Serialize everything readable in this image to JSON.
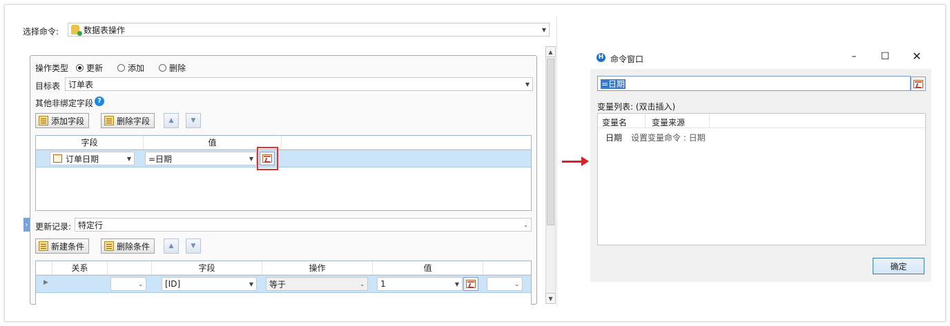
{
  "left": {
    "select_command": {
      "label": "选择命令:",
      "value": "数据表操作"
    },
    "op_type": {
      "label": "操作类型",
      "options": [
        "更新",
        "添加",
        "删除"
      ],
      "selected": "更新"
    },
    "target_table": {
      "label": "目标表",
      "value": "订单表"
    },
    "other_fields": {
      "label": "其他非绑定字段"
    },
    "field_toolbar": {
      "add": "添加字段",
      "delete": "删除字段"
    },
    "field_grid": {
      "headers": [
        "字段",
        "值"
      ],
      "row": {
        "field": "订单日期",
        "value": "=日期"
      }
    },
    "update_records": {
      "label": "更新记录:",
      "value": "特定行"
    },
    "cond_toolbar": {
      "add": "新建条件",
      "delete": "删除条件"
    },
    "cond_grid": {
      "headers": [
        "关系",
        "字段",
        "操作",
        "值"
      ],
      "row": {
        "relation": "",
        "field": "[ID]",
        "op": "等于",
        "value": "1"
      }
    }
  },
  "dialog": {
    "title": "命令窗口",
    "formula": "=日期",
    "var_list_label": "变量列表: (双击插入)",
    "columns": [
      "变量名",
      "变量来源"
    ],
    "rows": [
      {
        "name": "日期",
        "source": "设置变量命令 : 日期"
      }
    ],
    "ok": "确定"
  },
  "colors": {
    "highlight": "#e03030",
    "arrow": "#d8232a",
    "selection": "#cce4f7"
  }
}
